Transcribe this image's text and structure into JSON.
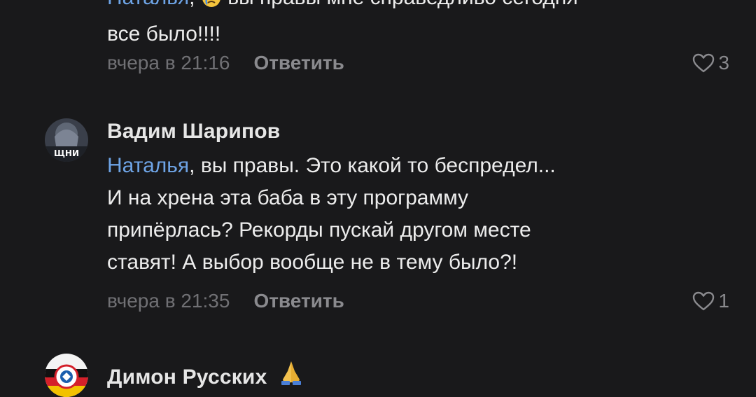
{
  "comments": [
    {
      "mention": "Наталья",
      "lines": [
        "вы правы мне справедливо сегодня",
        "все было!!!!"
      ],
      "time": "вчера в 21:16",
      "reply_label": "Ответить",
      "likes": "3"
    },
    {
      "author": "Вадим Шарипов",
      "avatar_text": "ЩНИ",
      "mention": "Наталья",
      "first_line_rest": ", вы правы. Это какой то беспредел...",
      "lines": [
        "И на хрена эта баба в эту программу",
        "припёрлась? Рекорды пускай другом месте",
        "ставят! А выбор вообще не в тему было?!"
      ],
      "time": "вчера в 21:35",
      "reply_label": "Ответить",
      "likes": "1"
    },
    {
      "author": "Димон Русских",
      "emoji": "praying-hands-icon"
    }
  ],
  "colors": {
    "background": "#19191b",
    "mention": "#6ea4e6",
    "meta": "#707074"
  }
}
